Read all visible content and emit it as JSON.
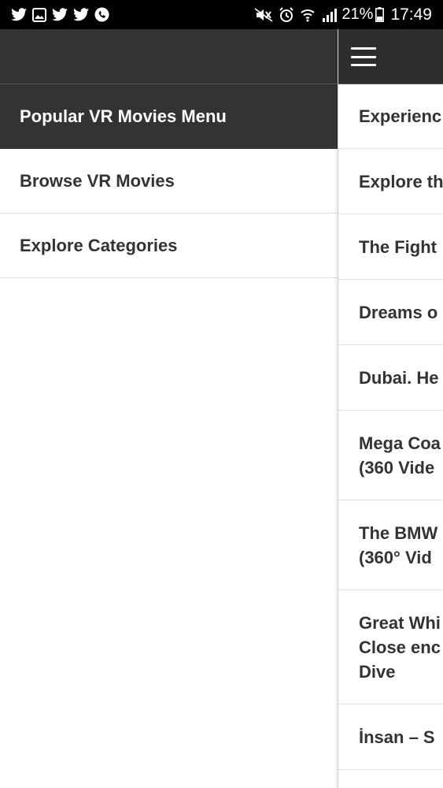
{
  "status_bar": {
    "left_icons": [
      "twitter-icon",
      "gallery-icon",
      "twitter-icon",
      "twitter-icon",
      "phone-icon"
    ],
    "right_icons": [
      "mute-icon",
      "alarm-icon",
      "wifi-icon",
      "signal-icon"
    ],
    "battery": "21%",
    "time": "17:49"
  },
  "drawer": {
    "items": [
      {
        "label": "Popular VR Movies Menu",
        "active": true
      },
      {
        "label": "Browse VR Movies"
      },
      {
        "label": "Explore Categories"
      }
    ]
  },
  "main": {
    "menu_icon": "hamburger-icon",
    "items": [
      {
        "lines": [
          "Experienc"
        ]
      },
      {
        "lines": [
          "Explore th"
        ]
      },
      {
        "lines": [
          "The Fight"
        ]
      },
      {
        "lines": [
          "Dreams o"
        ]
      },
      {
        "lines": [
          "Dubai. He"
        ]
      },
      {
        "lines": [
          "Mega Coa",
          "(360 Vide"
        ]
      },
      {
        "lines": [
          "The BMW",
          "(360° Vid"
        ]
      },
      {
        "lines": [
          "Great Whi",
          "Close enc",
          "Dive"
        ]
      },
      {
        "lines": [
          "İnsan – S"
        ]
      }
    ]
  },
  "colors": {
    "status_bar": "#000000",
    "header": "#333333",
    "active_item": "#333333",
    "text": "#333333",
    "divider": "#dddddd"
  }
}
